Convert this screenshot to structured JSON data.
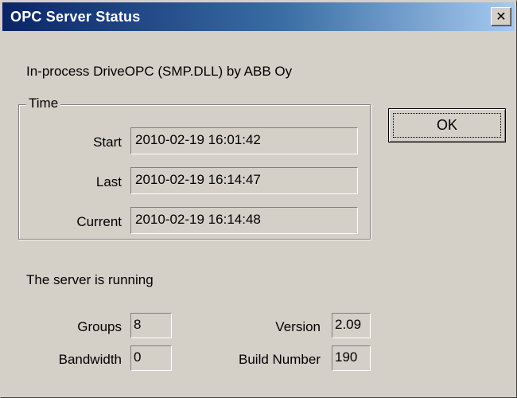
{
  "window": {
    "title": "OPC Server Status",
    "close_glyph": "✕"
  },
  "description": "In-process DriveOPC (SMP.DLL) by ABB Oy",
  "time_group": {
    "legend": "Time",
    "start_label": "Start",
    "start_value": "2010-02-19 16:01:42",
    "last_label": "Last",
    "last_value": "2010-02-19 16:14:47",
    "current_label": "Current",
    "current_value": "2010-02-19 16:14:48"
  },
  "ok_label": "OK",
  "status_text": "The server is running",
  "stats": {
    "groups_label": "Groups",
    "groups_value": "8",
    "bandwidth_label": "Bandwidth",
    "bandwidth_value": "0",
    "version_label": "Version",
    "version_value": "2.09",
    "build_label": "Build Number",
    "build_value": "190"
  }
}
